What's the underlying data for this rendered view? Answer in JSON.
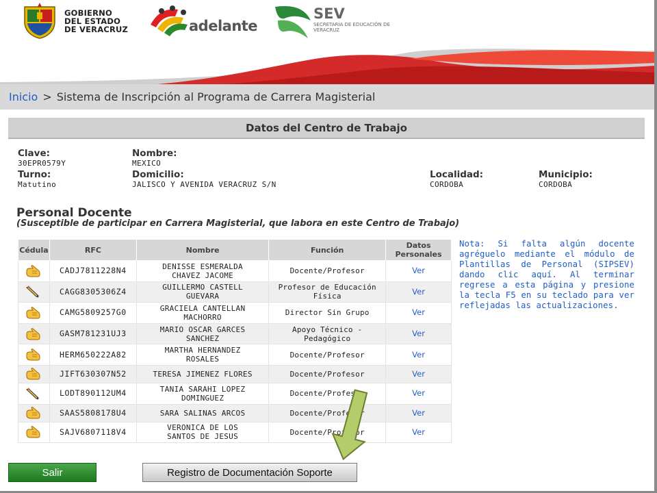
{
  "header": {
    "gobierno_lines": [
      "GOBIERNO",
      "DEL ESTADO",
      "DE VERACRUZ"
    ],
    "adelante": "adelante",
    "sev": "SEV",
    "sev_sub": "SECRETARÍA DE EDUCACIÓN DE VERACRUZ"
  },
  "breadcrumb": {
    "home": "Inicio",
    "separator": ">",
    "current": "Sistema de Inscripción al Programa de Carrera Magisterial"
  },
  "section_title": "Datos del Centro de Trabajo",
  "centro": {
    "clave_label": "Clave:",
    "clave": "30EPR0579Y",
    "nombre_label": "Nombre:",
    "nombre": "MEXICO",
    "turno_label": "Turno:",
    "turno": "Matutino",
    "domicilio_label": "Domicilio:",
    "domicilio": "JALISCO Y AVENIDA VERACRUZ S/N",
    "localidad_label": "Localidad:",
    "localidad": "CORDOBA",
    "municipio_label": "Municipio:",
    "municipio": "CORDOBA"
  },
  "personal": {
    "title": "Personal Docente",
    "subtitle": "(Susceptible de participar en Carrera Magisterial, que labora en este Centro de Trabajo)"
  },
  "table": {
    "headers": [
      "Cédula",
      "RFC",
      "Nombre",
      "Función",
      "Datos Personales"
    ],
    "rows": [
      {
        "icon": "hand-pointer-icon",
        "rfc": "CADJ7811228N4",
        "name1": "DENISSE ESMERALDA",
        "name2": "CHAVEZ JACOME",
        "func1": "Docente/Profesor",
        "func2": "",
        "link": "Ver"
      },
      {
        "icon": "pencil-icon",
        "rfc": "CAGG8305306Z4",
        "name1": "GUILLERMO CASTELL",
        "name2": "GUEVARA",
        "func1": "Profesor de Educación",
        "func2": "Física",
        "link": "Ver"
      },
      {
        "icon": "hand-pointer-icon",
        "rfc": "CAMG5809257G0",
        "name1": "GRACIELA CANTELLAN",
        "name2": "MACHORRO",
        "func1": "Director Sin Grupo",
        "func2": "",
        "link": "Ver"
      },
      {
        "icon": "hand-pointer-icon",
        "rfc": "GASM781231UJ3",
        "name1": "MARIO OSCAR GARCES",
        "name2": "SANCHEZ",
        "func1": "Apoyo Técnico -",
        "func2": "Pedagógico",
        "link": "Ver"
      },
      {
        "icon": "hand-pointer-icon",
        "rfc": "HERM650222A82",
        "name1": "MARTHA HERNANDEZ",
        "name2": "ROSALES",
        "func1": "Docente/Profesor",
        "func2": "",
        "link": "Ver"
      },
      {
        "icon": "hand-pointer-icon",
        "rfc": "JIFT630307N52",
        "name1": "TERESA JIMENEZ FLORES",
        "name2": "",
        "func1": "Docente/Profesor",
        "func2": "",
        "link": "Ver"
      },
      {
        "icon": "pencil-icon",
        "rfc": "LODT890112UM4",
        "name1": "TANIA SARAHI LOPEZ",
        "name2": "DOMINGUEZ",
        "func1": "Docente/Profesor",
        "func2": "",
        "link": "Ver"
      },
      {
        "icon": "hand-pointer-icon",
        "rfc": "SAAS5808178U4",
        "name1": "SARA SALINAS ARCOS",
        "name2": "",
        "func1": "Docente/Profesor",
        "func2": "",
        "link": "Ver"
      },
      {
        "icon": "hand-pointer-icon",
        "rfc": "SAJV6807118V4",
        "name1": "VERONICA DE LOS",
        "name2": "SANTOS DE JESUS",
        "func1": "Docente/Profesor",
        "func2": "",
        "link": "Ver"
      }
    ]
  },
  "note": "Nota: Si falta algún docente agréguelo mediante el módulo de Plantillas de Personal (SIPSEV) dando clic aquí. Al terminar regrese a esta página y presione la tecla F5 en su teclado para ver reflejadas las actualizaciones.",
  "buttons": {
    "salir": "Salir",
    "registro": "Registro de Documentación Soporte"
  },
  "colors": {
    "link_blue": "#1f5ec3",
    "header_gray": "#d0d0d0",
    "salir_green": "#2e8b2e",
    "arrow_green": "#b5cc6a",
    "swoosh_red": "#d42a2a"
  }
}
